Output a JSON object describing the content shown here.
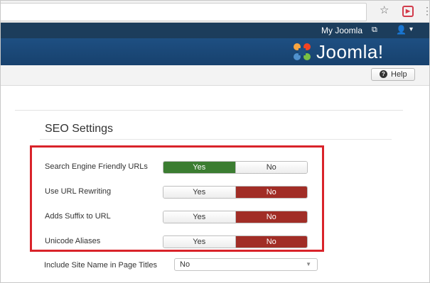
{
  "browser": {
    "star_icon": "star-icon",
    "extension_icon": "extension-icon",
    "menu_icon": "kebab-menu-icon"
  },
  "statusbar": {
    "my_joomla": "My Joomla",
    "user_icon": "user-icon"
  },
  "header": {
    "brand": "Joomla!"
  },
  "toolbar": {
    "help_label": "Help"
  },
  "section": {
    "title": "SEO Settings"
  },
  "settings": [
    {
      "label": "Search Engine Friendly URLs",
      "yes": "Yes",
      "no": "No",
      "selected": "Yes"
    },
    {
      "label": "Use URL Rewriting",
      "yes": "Yes",
      "no": "No",
      "selected": "No"
    },
    {
      "label": "Adds Suffix to URL",
      "yes": "Yes",
      "no": "No",
      "selected": "No"
    },
    {
      "label": "Unicode Aliases",
      "yes": "Yes",
      "no": "No",
      "selected": "No"
    }
  ],
  "site_name": {
    "label": "Include Site Name in Page Titles",
    "value": "No"
  },
  "colors": {
    "status_bar": "#1c3d5c",
    "header": "#1e4f82",
    "yes_active": "#3b7d31",
    "no_active": "#a12d26",
    "highlight": "#d9232a"
  }
}
